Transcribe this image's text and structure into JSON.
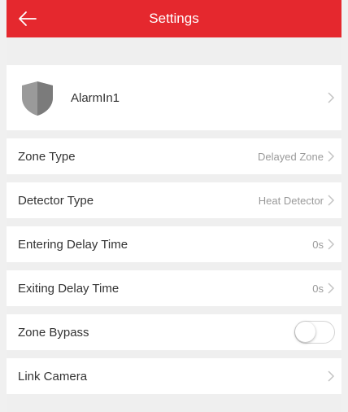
{
  "colors": {
    "nav_bar": "#e5282e",
    "background": "#efefef",
    "row": "#ffffff",
    "value_text": "#9a9a9a",
    "shield": "#8c8c8c"
  },
  "nav": {
    "title": "Settings",
    "back_icon": "arrow-left-icon"
  },
  "device": {
    "name": "AlarmIn1",
    "icon": "shield-icon"
  },
  "settings": {
    "zone_type": {
      "label": "Zone Type",
      "value": "Delayed Zone"
    },
    "detector_type": {
      "label": "Detector Type",
      "value": "Heat Detector"
    },
    "entering_delay": {
      "label": "Entering Delay Time",
      "value": "0s"
    },
    "exiting_delay": {
      "label": "Exiting Delay Time",
      "value": "0s"
    },
    "zone_bypass": {
      "label": "Zone Bypass",
      "enabled": false
    },
    "link_camera": {
      "label": "Link Camera"
    }
  }
}
